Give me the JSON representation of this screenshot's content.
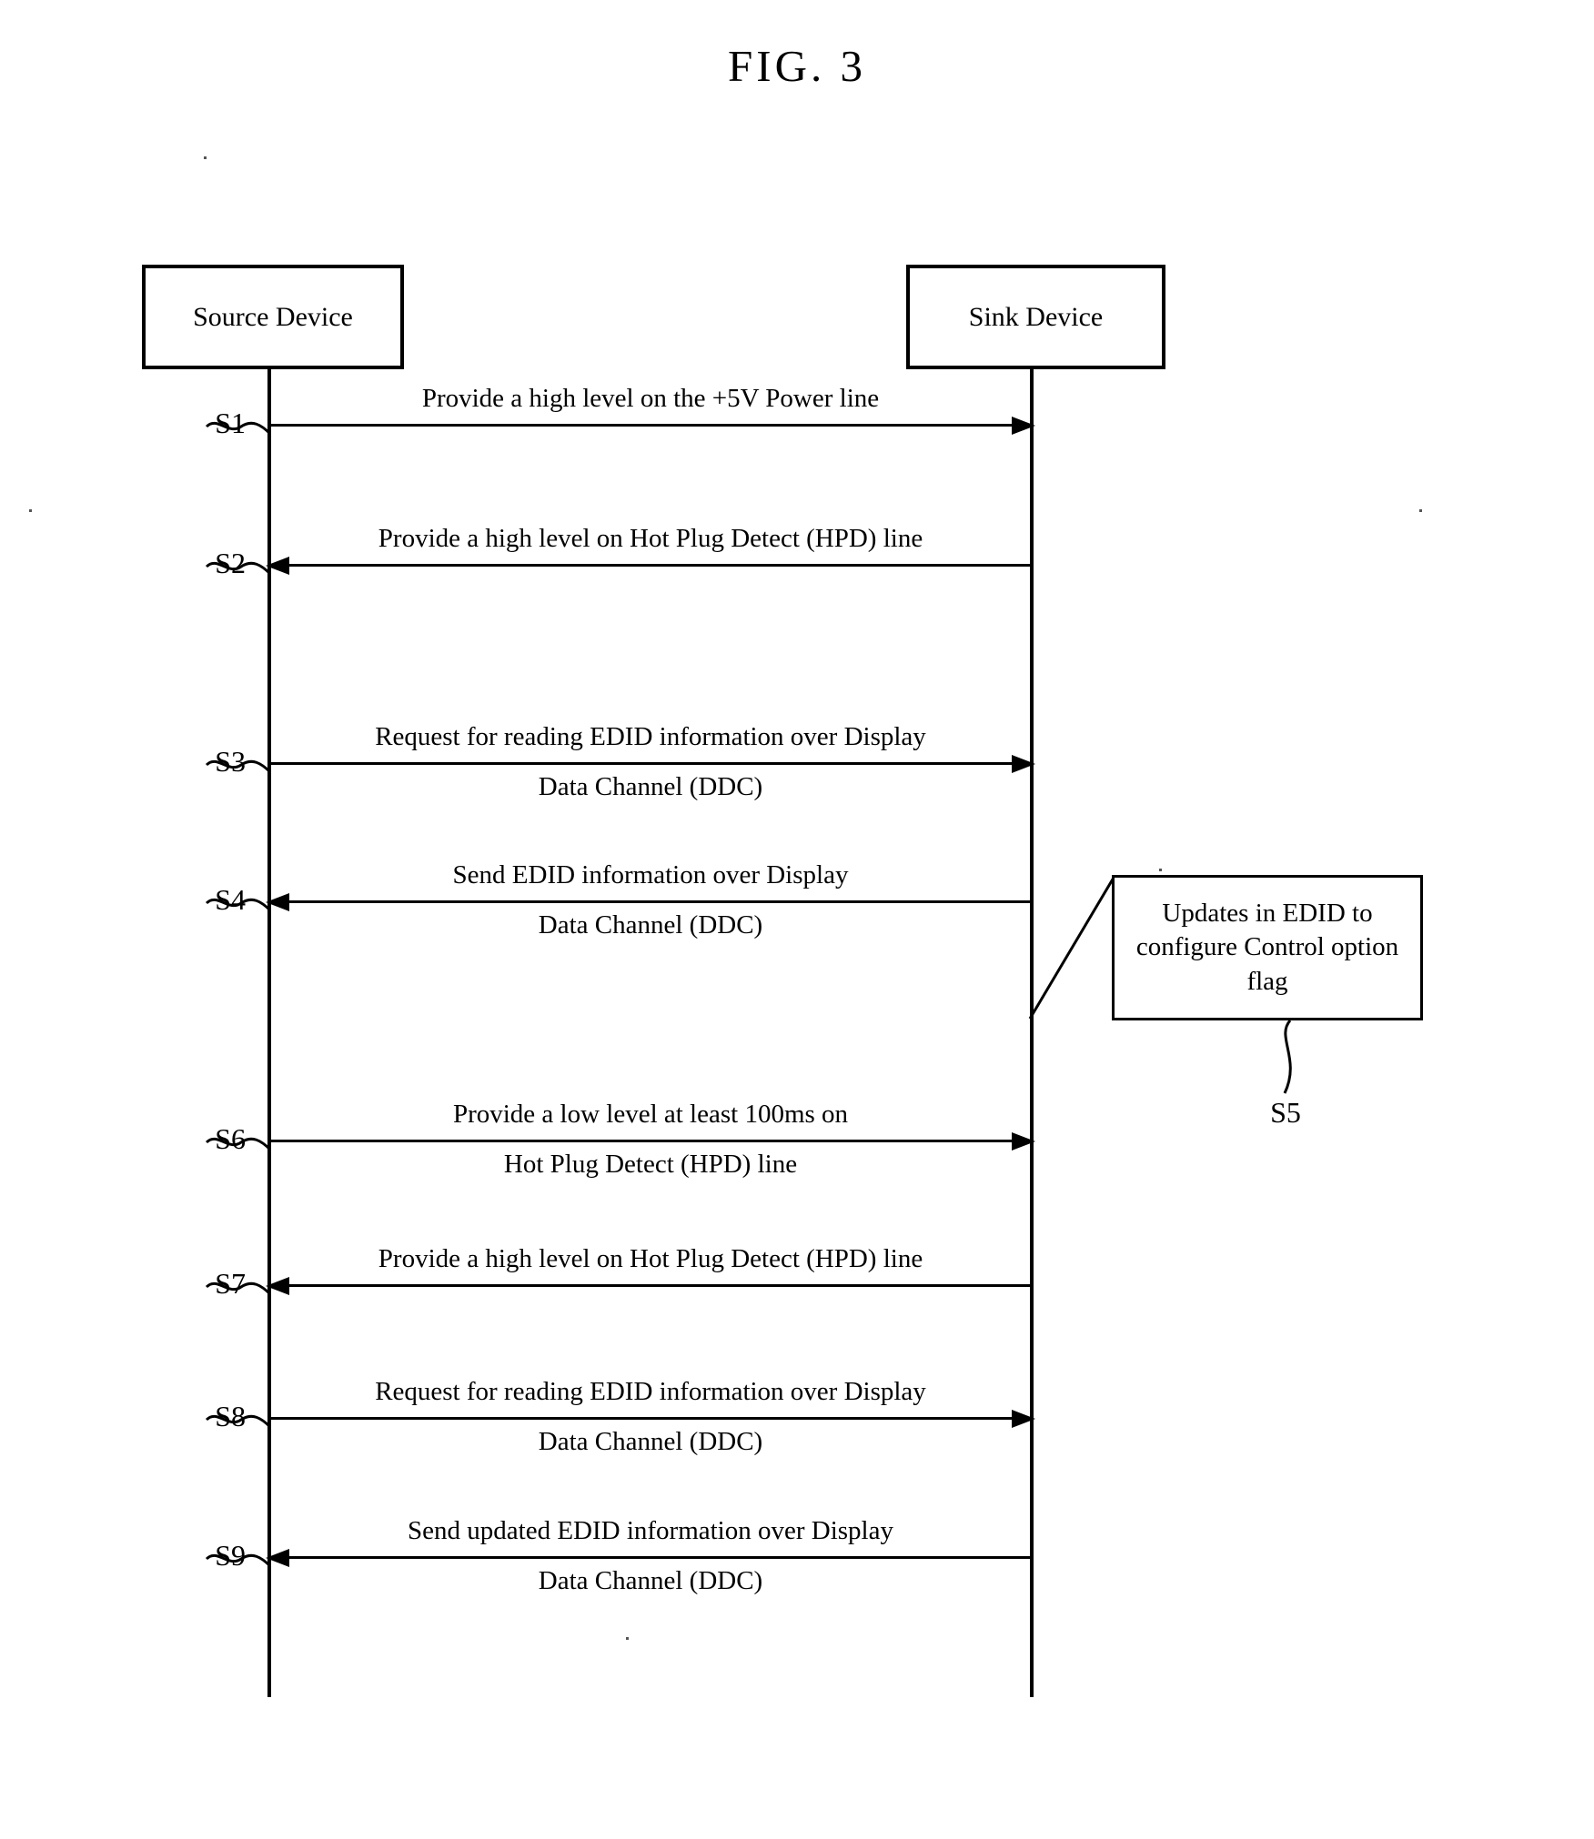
{
  "figure": {
    "title": "FIG. 3"
  },
  "participants": [
    {
      "id": "source",
      "label": "Source Device"
    },
    {
      "id": "sink",
      "label": "Sink Device"
    }
  ],
  "messages": [
    {
      "step": "S1",
      "direction": "right",
      "text_above": "Provide a high level on the +5V Power line",
      "text_below": ""
    },
    {
      "step": "S2",
      "direction": "left",
      "text_above": "Provide a high level on Hot Plug Detect (HPD) line",
      "text_below": ""
    },
    {
      "step": "S3",
      "direction": "right",
      "text_above": "Request for reading EDID information over Display",
      "text_below": "Data Channel (DDC)"
    },
    {
      "step": "S4",
      "direction": "left",
      "text_above": "Send EDID information over Display",
      "text_below": "Data Channel (DDC)"
    },
    {
      "step": "S6",
      "direction": "right",
      "text_above": "Provide a low level at least 100ms on",
      "text_below": "Hot Plug Detect (HPD) line"
    },
    {
      "step": "S7",
      "direction": "left",
      "text_above": "Provide a high level on Hot Plug Detect (HPD) line",
      "text_below": ""
    },
    {
      "step": "S8",
      "direction": "right",
      "text_above": "Request for reading EDID information over Display",
      "text_below": "Data Channel (DDC)"
    },
    {
      "step": "S9",
      "direction": "left",
      "text_above": "Send updated EDID information over Display",
      "text_below": "Data Channel (DDC)"
    }
  ],
  "note": {
    "step": "S5",
    "line1": "Updates in EDID to",
    "line2": "configure Control option flag"
  },
  "colors": {
    "ink": "#000000",
    "paper": "#ffffff"
  }
}
